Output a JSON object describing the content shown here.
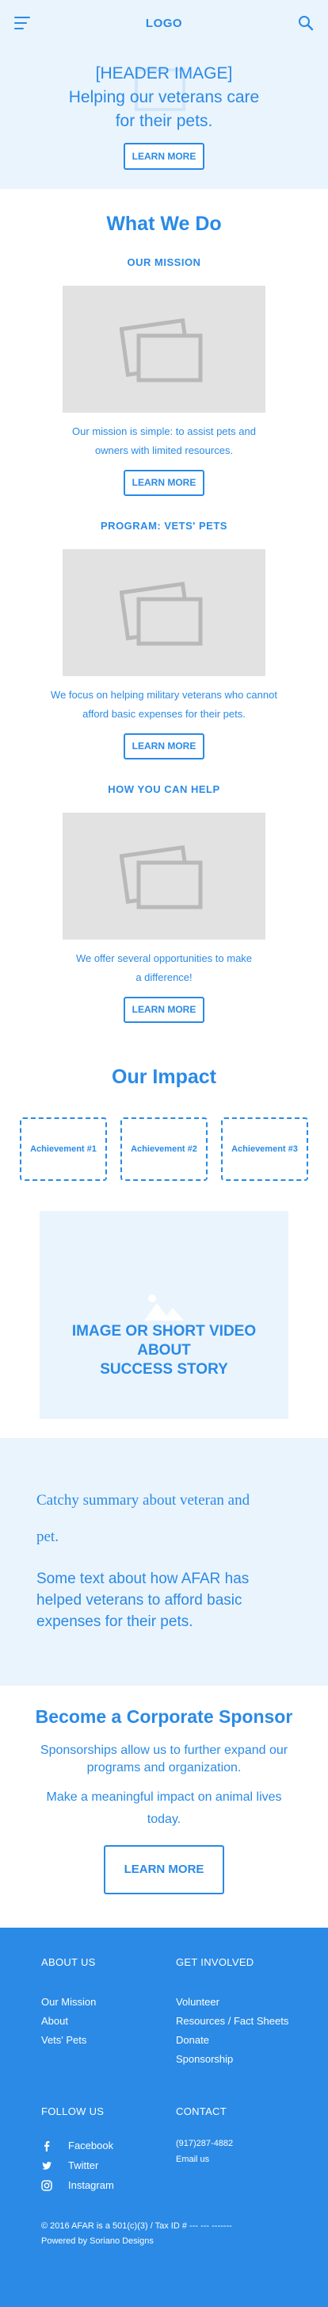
{
  "header": {
    "logo": "LOGO"
  },
  "hero": {
    "image_label": "[HEADER IMAGE]",
    "tagline_line1": "Helping our veterans care",
    "tagline_line2": "for their pets.",
    "button": "LEARN MORE"
  },
  "what_we_do": {
    "title": "What We Do",
    "items": [
      {
        "title": "OUR MISSION",
        "desc_line1": "Our mission is simple: to assist pets and",
        "desc_line2": "owners with limited resources.",
        "button": "LEARN MORE"
      },
      {
        "title": "PROGRAM: VETS' PETS",
        "desc_line1": "We focus on helping military veterans who cannot",
        "desc_line2": "afford basic expenses for their pets.",
        "button": "LEARN MORE"
      },
      {
        "title": "HOW YOU CAN HELP",
        "desc_line1": "We offer several opportunities to make",
        "desc_line2": "a difference!",
        "button": "LEARN MORE"
      }
    ]
  },
  "impact": {
    "title": "Our Impact",
    "achievements": [
      "Achievement #1",
      "Achievement #2",
      "Achievement #3"
    ],
    "story_line1": "IMAGE OR SHORT VIDEO",
    "story_line2": "ABOUT",
    "story_line3": "SUCCESS STORY"
  },
  "summary": {
    "headline_line1": "Catchy summary about veteran and",
    "headline_line2": "pet.",
    "text": "Some text about how AFAR has helped veterans to afford basic expenses for their pets."
  },
  "sponsor": {
    "title": "Become a Corporate Sponsor",
    "text": "Sponsorships allow us to further expand our programs and organization.",
    "text2": "Make a meaningful impact on animal lives today.",
    "button": "LEARN MORE"
  },
  "footer": {
    "about_heading": "ABOUT US",
    "about_links": [
      "Our Mission",
      "About",
      "Vets' Pets"
    ],
    "involved_heading": "GET INVOLVED",
    "involved_links": [
      "Volunteer",
      "Resources / Fact Sheets",
      "Donate",
      "Sponsorship"
    ],
    "follow_heading": "FOLLOW US",
    "social": [
      "Facebook",
      "Twitter",
      "Instagram"
    ],
    "contact_heading": "CONTACT",
    "phone": "(917)287-4882",
    "email": "Email us",
    "copyright_line1": "© 2016 AFAR is a 501(c)(3) / Tax ID # --- --- -------",
    "copyright_line2": "Powered by Soriano Designs"
  },
  "colors": {
    "accent": "#2a8ae6",
    "light_bg": "#eaf4fd",
    "placeholder": "#e2e2e2"
  }
}
